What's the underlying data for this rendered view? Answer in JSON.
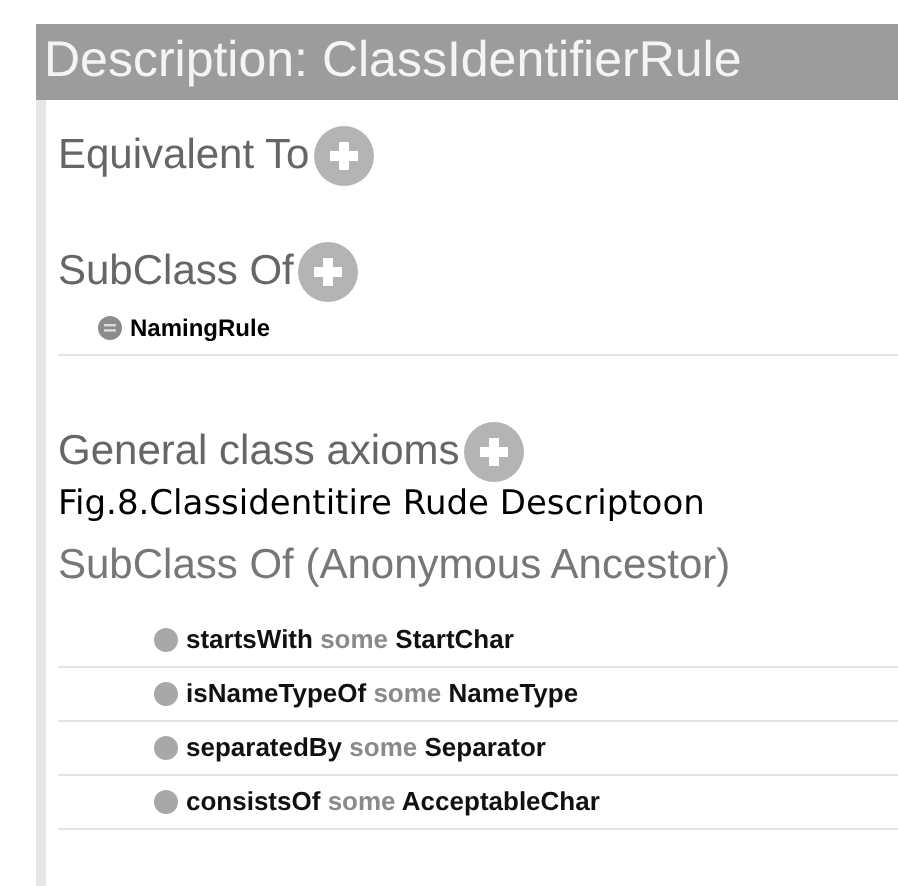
{
  "header": {
    "title": "Description: ClassIdentifierRule"
  },
  "sections": [
    {
      "title": "Equivalent To"
    },
    {
      "title": "SubClass Of",
      "items": [
        {
          "kind": "class",
          "text": "NamingRule"
        }
      ]
    },
    {
      "title": "General class axioms"
    }
  ],
  "caption": "Fig.8.Classidentitire Rude Descriptoon",
  "ancestors": {
    "title": "SubClass Of (Anonymous Ancestor)",
    "items": [
      {
        "kind": "restriction",
        "property": "startsWith",
        "keyword": "some",
        "filler": "StartChar"
      },
      {
        "kind": "restriction",
        "property": "isNameTypeOf",
        "keyword": "some",
        "filler": "NameType"
      },
      {
        "kind": "restriction",
        "property": "separatedBy",
        "keyword": "some",
        "filler": "Separator"
      },
      {
        "kind": "restriction",
        "property": "consistsOf",
        "keyword": "some",
        "filler": "AcceptableChar"
      }
    ]
  }
}
